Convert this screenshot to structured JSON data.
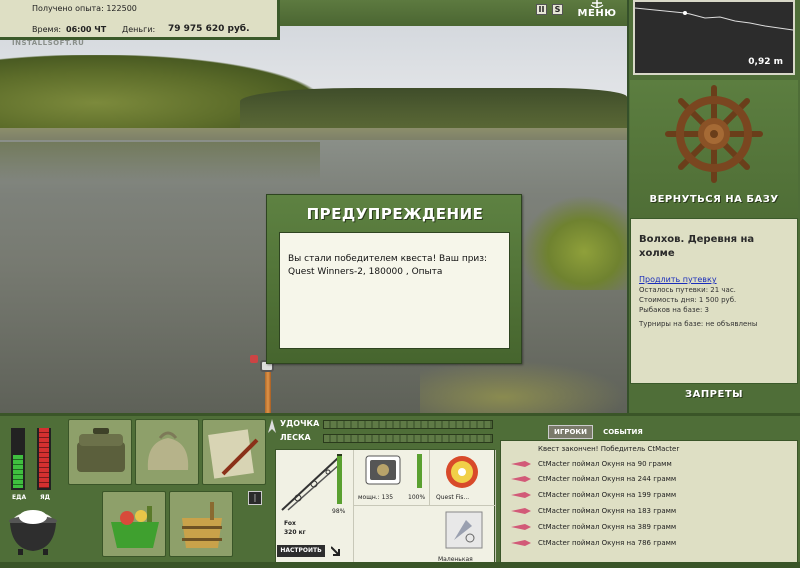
{
  "stats": {
    "exp_label": "Получено опыта:",
    "exp_value": "122500",
    "time_label": "Время:",
    "time_value": "06:00 ЧТ",
    "money_label": "Деньги:",
    "money_value": "79 975 620 руб."
  },
  "watermark": "INSTALLSOFT.RU",
  "top_controls": {
    "pause": "II",
    "sound": "S",
    "menu_label": "МЕНЮ"
  },
  "depth": {
    "value": "0,92 m"
  },
  "right_panel": {
    "return_label": "ВЕРНУТЬСЯ НА БАЗУ",
    "location": "Волхов. Деревня на холме",
    "extend_link": "Продлить путевку",
    "lines": [
      "Осталось путевки: 21 час.",
      "Стоимость дня: 1 500 руб.",
      "Рыбаков на базе: 3"
    ],
    "tournaments": "Турниры на базе: не объявлены",
    "bans_label": "ЗАПРЕТЫ"
  },
  "gauges": {
    "food_label": "ЕДА",
    "food_level": 0.55,
    "food_color": "#3fbf3f",
    "poison_label": "ЯД",
    "poison_level": 1.0,
    "poison_color": "#d43030"
  },
  "rod_panel": {
    "rod_label": "УДОЧКА",
    "line_label": "ЛЕСКА",
    "rod_name": "Fox",
    "rod_weight": "320 кг",
    "rod_pct": "98%",
    "reel_label": "мощн.: 135",
    "reel_pct": "100%",
    "line_name": "Quest Fis...",
    "lure_name": "Маленькая",
    "setup_label": "НАСТРОИТЬ"
  },
  "chat": {
    "tabs": [
      "ИГРОКИ",
      "СОБЫТИЯ"
    ],
    "first": "Квест закончен! Победитель CtMacter",
    "messages": [
      "CtMacter поймал Окуня на 90 грамм",
      "CtMacter поймал Окуня на 244 грамм",
      "CtMacter поймал Окуня на 199 грамм",
      "CtMacter поймал Окуня на 183 грамм",
      "CtMacter поймал Окуня на 389 грамм",
      "CtMacter поймал Окуня на 786 грамм"
    ]
  },
  "dialog": {
    "title": "ПРЕДУПРЕЖДЕНИЕ",
    "line1": "Вы стали победителем квеста! Ваш приз:",
    "line2": "Quest Winners-2, 180000 , Опыта"
  }
}
